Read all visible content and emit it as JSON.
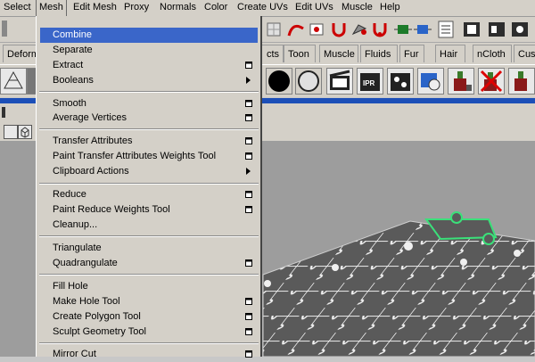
{
  "menubar": {
    "items": [
      "Select",
      "Mesh",
      "Edit Mesh",
      "Proxy",
      "Normals",
      "Color",
      "Create UVs",
      "Edit UVs",
      "Muscle",
      "Help"
    ],
    "open_item": "Mesh"
  },
  "shelf_tabs": [
    "Deform",
    "cts",
    "Toon",
    "Muscle",
    "Fluids",
    "Fur",
    "Hair",
    "nCloth",
    "Cust"
  ],
  "mesh_menu": {
    "items": [
      {
        "label": "Combine",
        "highlighted": true,
        "option_box": false,
        "submenu": false
      },
      {
        "label": "Separate",
        "option_box": false,
        "submenu": false
      },
      {
        "label": "Extract",
        "option_box": true,
        "submenu": false
      },
      {
        "label": "Booleans",
        "option_box": false,
        "submenu": true
      },
      {
        "label": "Smooth",
        "option_box": true,
        "submenu": false
      },
      {
        "label": "Average Vertices",
        "option_box": true,
        "submenu": false
      },
      {
        "label": "Transfer Attributes",
        "option_box": true,
        "submenu": false
      },
      {
        "label": "Paint Transfer Attributes Weights Tool",
        "option_box": true,
        "submenu": false
      },
      {
        "label": "Clipboard Actions",
        "option_box": false,
        "submenu": true
      },
      {
        "label": "Reduce",
        "option_box": true,
        "submenu": false
      },
      {
        "label": "Paint Reduce Weights Tool",
        "option_box": true,
        "submenu": false
      },
      {
        "label": "Cleanup...",
        "option_box": false,
        "submenu": false
      },
      {
        "label": "Triangulate",
        "option_box": false,
        "submenu": false
      },
      {
        "label": "Quadrangulate",
        "option_box": true,
        "submenu": false
      },
      {
        "label": "Fill Hole",
        "option_box": false,
        "submenu": false
      },
      {
        "label": "Make Hole Tool",
        "option_box": true,
        "submenu": false
      },
      {
        "label": "Create Polygon Tool",
        "option_box": true,
        "submenu": false
      },
      {
        "label": "Sculpt Geometry Tool",
        "option_box": true,
        "submenu": false
      },
      {
        "label": "Mirror Cut",
        "option_box": true,
        "submenu": false
      }
    ]
  },
  "colors": {
    "menu_bg": "#d4d0c8",
    "highlight": "#3a66c9",
    "viewport_bg": "#9d9d9d",
    "puzzle_fill": "#5a5a5a",
    "puzzle_lines": "#f0f0f0",
    "selection_green": "#3be07a"
  }
}
